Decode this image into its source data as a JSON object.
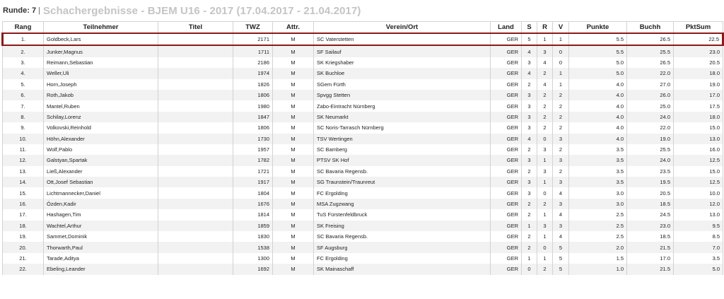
{
  "header": {
    "round_label": "Runde: 7",
    "separator": "|",
    "title": "Schachergebnisse - BJEM U16 - 2017 (17.04.2017 - 21.04.2017)"
  },
  "columns": [
    "Rang",
    "Teilnehmer",
    "Titel",
    "TWZ",
    "Attr.",
    "Verein/Ort",
    "Land",
    "S",
    "R",
    "V",
    "Punkte",
    "Buchh",
    "PktSum"
  ],
  "highlight_color": "#8b1a1a",
  "rows": [
    {
      "rang": "1.",
      "name": "Goldbeck,Lars",
      "titel": "",
      "twz": "2171",
      "attr": "M",
      "verein": "SC Vaterstetten",
      "land": "GER",
      "s": "5",
      "r": "1",
      "v": "1",
      "punkte": "5.5",
      "buchh": "26.5",
      "pktsum": "22.5"
    },
    {
      "rang": "2.",
      "name": "Junker,Magnus",
      "titel": "",
      "twz": "1711",
      "attr": "M",
      "verein": "SF Sailauf",
      "land": "GER",
      "s": "4",
      "r": "3",
      "v": "0",
      "punkte": "5.5",
      "buchh": "25.5",
      "pktsum": "23.0"
    },
    {
      "rang": "3.",
      "name": "Reimann,Sebastian",
      "titel": "",
      "twz": "2186",
      "attr": "M",
      "verein": "SK Kriegshaber",
      "land": "GER",
      "s": "3",
      "r": "4",
      "v": "0",
      "punkte": "5.0",
      "buchh": "26.5",
      "pktsum": "20.5"
    },
    {
      "rang": "4.",
      "name": "Weller,Uli",
      "titel": "",
      "twz": "1974",
      "attr": "M",
      "verein": "SK Buchloe",
      "land": "GER",
      "s": "4",
      "r": "2",
      "v": "1",
      "punkte": "5.0",
      "buchh": "22.0",
      "pktsum": "18.0"
    },
    {
      "rang": "5.",
      "name": "Horn,Joseph",
      "titel": "",
      "twz": "1826",
      "attr": "M",
      "verein": "SGem Fürth",
      "land": "GER",
      "s": "2",
      "r": "4",
      "v": "1",
      "punkte": "4.0",
      "buchh": "27.0",
      "pktsum": "19.0"
    },
    {
      "rang": "6.",
      "name": "Roth,Jakob",
      "titel": "",
      "twz": "1806",
      "attr": "M",
      "verein": "Spvgg Stetten",
      "land": "GER",
      "s": "3",
      "r": "2",
      "v": "2",
      "punkte": "4.0",
      "buchh": "26.0",
      "pktsum": "17.0"
    },
    {
      "rang": "7.",
      "name": "Mantel,Ruben",
      "titel": "",
      "twz": "1980",
      "attr": "M",
      "verein": "Zabo-Eintracht Nürnberg",
      "land": "GER",
      "s": "3",
      "r": "2",
      "v": "2",
      "punkte": "4.0",
      "buchh": "25.0",
      "pktsum": "17.5"
    },
    {
      "rang": "8.",
      "name": "Schilay,Lorenz",
      "titel": "",
      "twz": "1847",
      "attr": "M",
      "verein": "SK Neumarkt",
      "land": "GER",
      "s": "3",
      "r": "2",
      "v": "2",
      "punkte": "4.0",
      "buchh": "24.0",
      "pktsum": "18.0"
    },
    {
      "rang": "9.",
      "name": "Volkovski,Reinhold",
      "titel": "",
      "twz": "1806",
      "attr": "M",
      "verein": "SC Noris-Tarrasch Nürnberg",
      "land": "GER",
      "s": "3",
      "r": "2",
      "v": "2",
      "punkte": "4.0",
      "buchh": "22.0",
      "pktsum": "15.0"
    },
    {
      "rang": "10.",
      "name": "Höhn,Alexander",
      "titel": "",
      "twz": "1730",
      "attr": "M",
      "verein": "TSV Wertingen",
      "land": "GER",
      "s": "4",
      "r": "0",
      "v": "3",
      "punkte": "4.0",
      "buchh": "19.0",
      "pktsum": "13.0"
    },
    {
      "rang": "11.",
      "name": "Wolf,Pablo",
      "titel": "",
      "twz": "1957",
      "attr": "M",
      "verein": "SC Bamberg",
      "land": "GER",
      "s": "2",
      "r": "3",
      "v": "2",
      "punkte": "3.5",
      "buchh": "25.5",
      "pktsum": "16.0"
    },
    {
      "rang": "12.",
      "name": "Galstyan,Spartak",
      "titel": "",
      "twz": "1782",
      "attr": "M",
      "verein": "PTSV SK Hof",
      "land": "GER",
      "s": "3",
      "r": "1",
      "v": "3",
      "punkte": "3.5",
      "buchh": "24.0",
      "pktsum": "12.5"
    },
    {
      "rang": "13.",
      "name": "Ließ,Alexander",
      "titel": "",
      "twz": "1721",
      "attr": "M",
      "verein": "SC Bavaria Regensb.",
      "land": "GER",
      "s": "2",
      "r": "3",
      "v": "2",
      "punkte": "3.5",
      "buchh": "23.5",
      "pktsum": "15.0"
    },
    {
      "rang": "14.",
      "name": "Ott,Josef Sebastian",
      "titel": "",
      "twz": "1917",
      "attr": "M",
      "verein": "SG Traunstein/Traunreut",
      "land": "GER",
      "s": "3",
      "r": "1",
      "v": "3",
      "punkte": "3.5",
      "buchh": "19.5",
      "pktsum": "12.5"
    },
    {
      "rang": "15.",
      "name": "Lichtmannecker,Daniel",
      "titel": "",
      "twz": "1804",
      "attr": "M",
      "verein": "FC Ergolding",
      "land": "GER",
      "s": "3",
      "r": "0",
      "v": "4",
      "punkte": "3.0",
      "buchh": "20.5",
      "pktsum": "10.0"
    },
    {
      "rang": "16.",
      "name": "Özden,Kadir",
      "titel": "",
      "twz": "1676",
      "attr": "M",
      "verein": "MSA Zugzwang",
      "land": "GER",
      "s": "2",
      "r": "2",
      "v": "3",
      "punkte": "3.0",
      "buchh": "18.5",
      "pktsum": "12.0"
    },
    {
      "rang": "17.",
      "name": "Hashagen,Tim",
      "titel": "",
      "twz": "1814",
      "attr": "M",
      "verein": "TuS Fürstenfeldbruck",
      "land": "GER",
      "s": "2",
      "r": "1",
      "v": "4",
      "punkte": "2.5",
      "buchh": "24.5",
      "pktsum": "13.0"
    },
    {
      "rang": "18.",
      "name": "Wachtel,Arthur",
      "titel": "",
      "twz": "1859",
      "attr": "M",
      "verein": "SK Freising",
      "land": "GER",
      "s": "1",
      "r": "3",
      "v": "3",
      "punkte": "2.5",
      "buchh": "23.0",
      "pktsum": "9.5"
    },
    {
      "rang": "19.",
      "name": "Sammet,Dominik",
      "titel": "",
      "twz": "1830",
      "attr": "M",
      "verein": "SC Bavaria Regensb.",
      "land": "GER",
      "s": "2",
      "r": "1",
      "v": "4",
      "punkte": "2.5",
      "buchh": "18.5",
      "pktsum": "8.5"
    },
    {
      "rang": "20.",
      "name": "Thorwarth,Paul",
      "titel": "",
      "twz": "1538",
      "attr": "M",
      "verein": "SF Augsburg",
      "land": "GER",
      "s": "2",
      "r": "0",
      "v": "5",
      "punkte": "2.0",
      "buchh": "21.5",
      "pktsum": "7.0"
    },
    {
      "rang": "21.",
      "name": "Tarade,Aditya",
      "titel": "",
      "twz": "1300",
      "attr": "M",
      "verein": "FC Ergolding",
      "land": "GER",
      "s": "1",
      "r": "1",
      "v": "5",
      "punkte": "1.5",
      "buchh": "17.0",
      "pktsum": "3.5"
    },
    {
      "rang": "22.",
      "name": "Ebeling,Leander",
      "titel": "",
      "twz": "1692",
      "attr": "M",
      "verein": "SK Mainaschaff",
      "land": "GER",
      "s": "0",
      "r": "2",
      "v": "5",
      "punkte": "1.0",
      "buchh": "21.5",
      "pktsum": "5.0"
    }
  ]
}
